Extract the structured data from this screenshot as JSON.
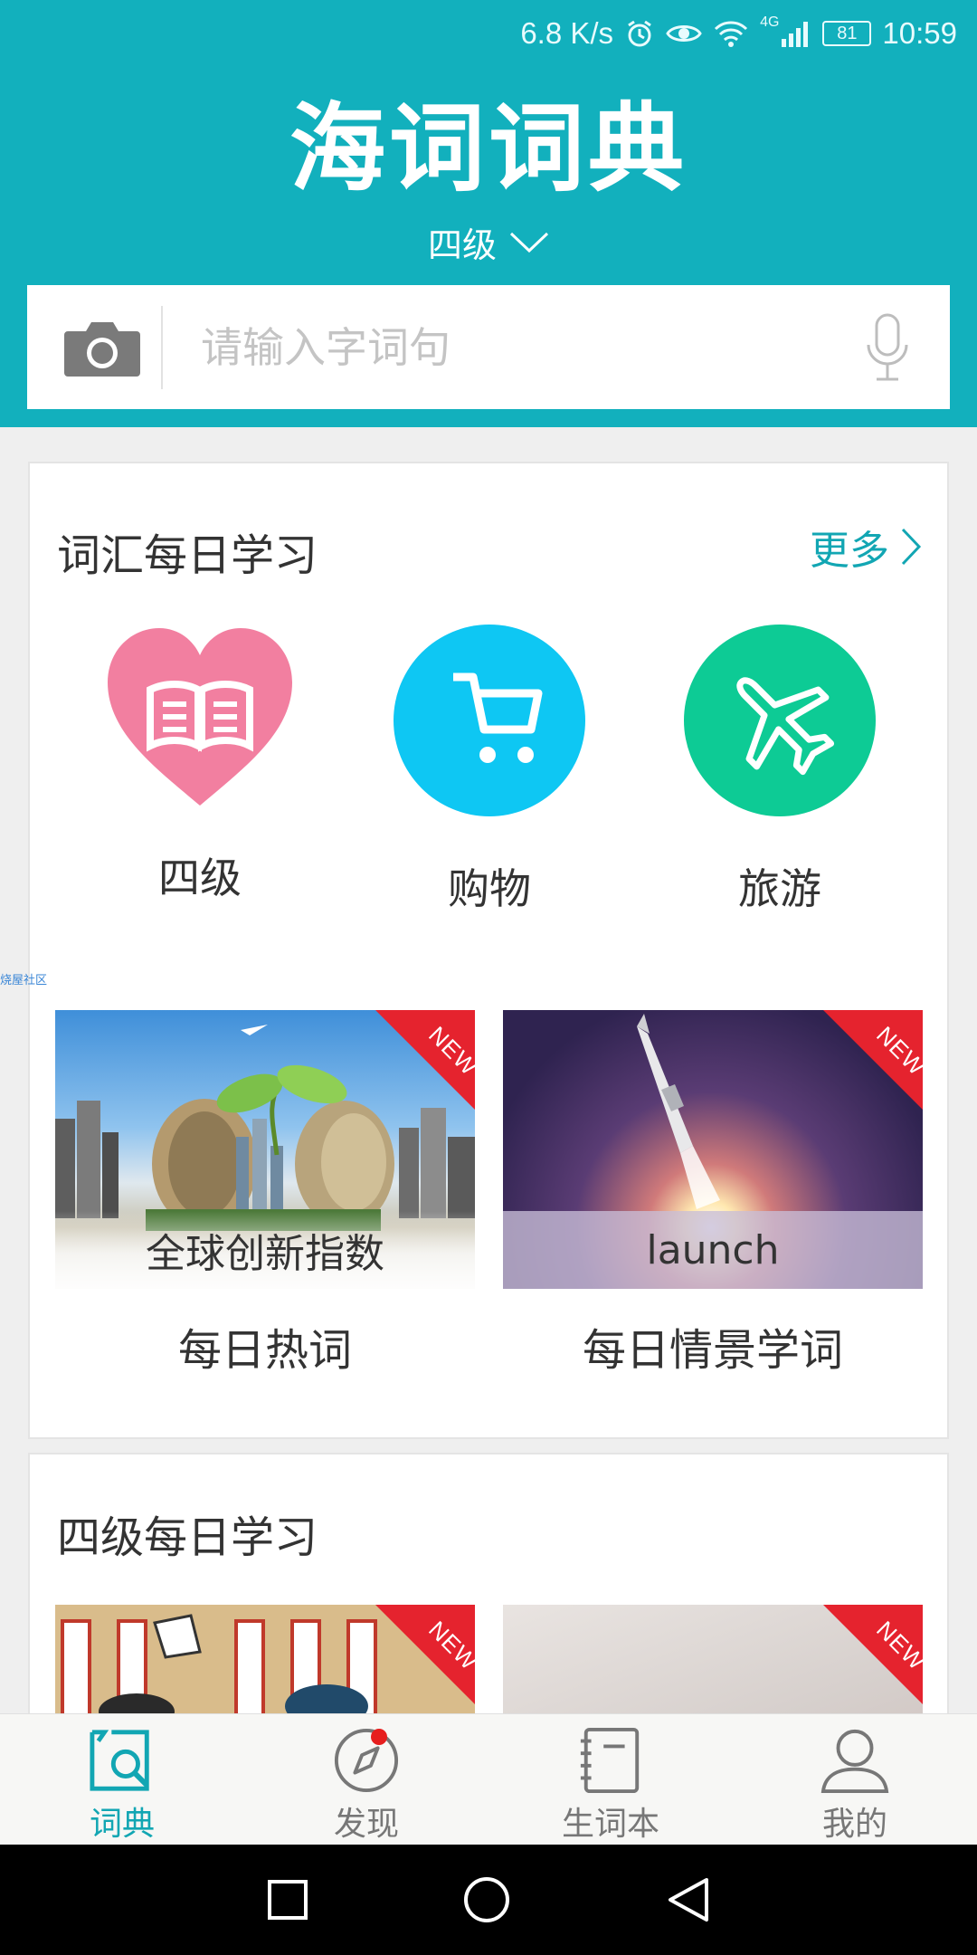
{
  "status_bar": {
    "speed": "6.8 K/s",
    "network": "4G",
    "battery": "81",
    "time": "10:59"
  },
  "header": {
    "logo": "海词词典",
    "level": "四级"
  },
  "search": {
    "placeholder": "请输入字词句"
  },
  "vocab_section": {
    "title": "词汇每日学习",
    "more": "更多",
    "categories": [
      {
        "label": "四级",
        "icon": "book-icon",
        "color": "#f27fa0"
      },
      {
        "label": "购物",
        "icon": "cart-icon",
        "color": "#0ec7f3"
      },
      {
        "label": "旅游",
        "icon": "airplane-icon",
        "color": "#0dcb95"
      }
    ],
    "tiles": [
      {
        "overlay": "全球创新指数",
        "caption": "每日热词",
        "badge": "NEW"
      },
      {
        "overlay": "launch",
        "caption": "每日情景学词",
        "badge": "NEW"
      }
    ]
  },
  "side_mark": "烧屋社区",
  "cet4_section": {
    "title": "四级每日学习",
    "badges": [
      "NEW",
      "NEW"
    ]
  },
  "tabbar": {
    "tabs": [
      {
        "label": "词典",
        "icon": "dictionary-icon",
        "active": true
      },
      {
        "label": "发现",
        "icon": "compass-icon",
        "active": false
      },
      {
        "label": "生词本",
        "icon": "notebook-icon",
        "active": false
      },
      {
        "label": "我的",
        "icon": "profile-icon",
        "active": false
      }
    ]
  },
  "colors": {
    "brand": "#12b0bd",
    "accent": "#12a6b3",
    "badge": "#e5232e"
  }
}
